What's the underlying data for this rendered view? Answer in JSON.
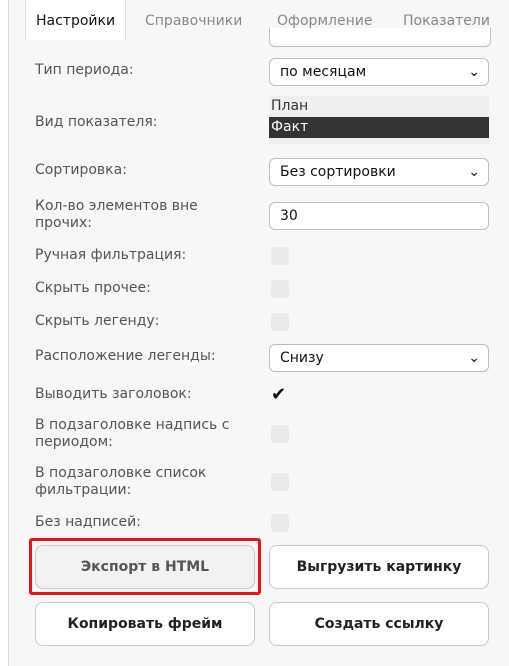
{
  "tabs": [
    "Настройки",
    "Справочники",
    "Оформление",
    "Показатели"
  ],
  "rows": {
    "period_type": {
      "label": "Тип периода:",
      "value": "по месяцам"
    },
    "indicator_kind": {
      "label": "Вид показателя:",
      "options": [
        "План",
        "Факт"
      ],
      "selected": "Факт"
    },
    "sorting": {
      "label": "Сортировка:",
      "value": "Без сортировки"
    },
    "elements_count": {
      "label": "Кол-во элементов вне прочих:",
      "value": "30"
    },
    "manual_filter": {
      "label": "Ручная фильтрация:",
      "checked": false
    },
    "hide_other": {
      "label": "Скрыть прочее:",
      "checked": false
    },
    "hide_legend": {
      "label": "Скрыть легенду:",
      "checked": false
    },
    "legend_position": {
      "label": "Расположение легенды:",
      "value": "Снизу"
    },
    "show_title": {
      "label": "Выводить заголовок:",
      "checked": true
    },
    "subtitle_period": {
      "label": "В подзаголовке надпись с периодом:",
      "checked": false
    },
    "subtitle_filter": {
      "label": "В подзаголовке список фильтрации:",
      "checked": false
    },
    "no_labels": {
      "label": "Без надписей:",
      "checked": false
    }
  },
  "buttons": {
    "export_html": "Экспорт в HTML",
    "download_image": "Выгрузить картинку",
    "copy_frame": "Копировать фрейм",
    "create_link": "Создать ссылку"
  },
  "colors": {
    "highlight": "#e8141b",
    "selected_option_bg": "#333333"
  },
  "icons": {
    "dropdown": "chevron-down-icon",
    "check": "checkmark-icon"
  }
}
